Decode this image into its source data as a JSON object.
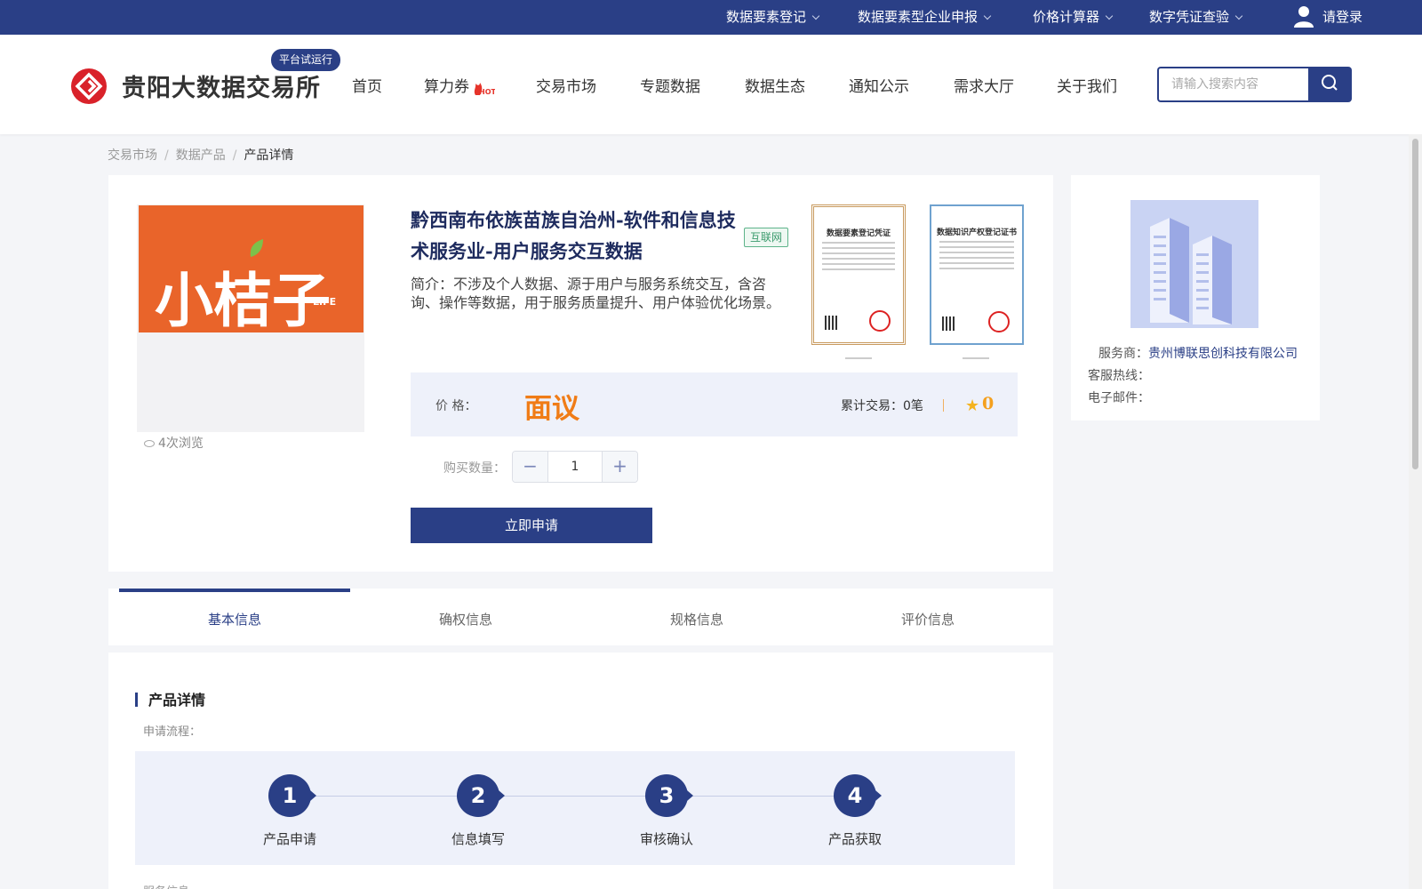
{
  "topbar": {
    "items": [
      "数据要素登记",
      "数据要素型企业申报",
      "价格计算器",
      "数字凭证查验"
    ],
    "login": "请登录"
  },
  "header": {
    "logo_text": "贵阳大数据交易所",
    "trial_badge": "平台试运行",
    "nav": [
      "首页",
      "算力券",
      "交易市场",
      "专题数据",
      "数据生态",
      "通知公示",
      "需求大厅",
      "关于我们"
    ],
    "hot_badge": "HOT",
    "search_placeholder": "请输入搜索内容"
  },
  "breadcrumb": [
    "交易市场",
    "数据产品",
    "产品详情"
  ],
  "product": {
    "thumb_text": "小桔子",
    "thumb_sub": "LIFE",
    "views": "4次浏览",
    "title": "黔西南布依族苗族自治州-软件和信息技术服务业-用户服务交互数据",
    "tag": "互联网",
    "intro": "简介：不涉及个人数据、源于用户与服务系统交互，含咨询、操作等数据，用于服务质量提升、用户体验优化场景。",
    "certificates": [
      "数据要素登记凭证",
      "数据知识产权登记证书"
    ],
    "price_label": "价 格：",
    "price_value": "面议",
    "deals_label": "累计交易：",
    "deals_value": "0笔",
    "rating": "0",
    "qty_label": "购买数量：",
    "qty_value": "1",
    "apply_button": "立即申请"
  },
  "vendor": {
    "provider_label": "服务商：",
    "provider_value": "贵州博联思创科技有限公司",
    "hotline_label": "客服热线：",
    "email_label": "电子邮件："
  },
  "tabs": [
    "基本信息",
    "确权信息",
    "规格信息",
    "评价信息"
  ],
  "detail": {
    "section_title": "产品详情",
    "flow_label": "申请流程：",
    "steps": [
      {
        "num": "1",
        "name": "产品申请"
      },
      {
        "num": "2",
        "name": "信息填写"
      },
      {
        "num": "3",
        "name": "审核确认"
      },
      {
        "num": "4",
        "name": "产品获取"
      }
    ],
    "service_label": "服务信息"
  },
  "colors": {
    "brand": "#2a3f86",
    "price": "#f07c16",
    "logo_red": "#d9222a",
    "thumb_orange": "#e9642a"
  }
}
